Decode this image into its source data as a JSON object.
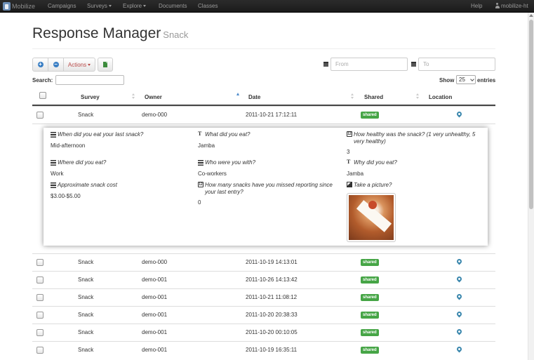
{
  "nav": {
    "brand": "Mobilize",
    "items": [
      {
        "label": "Campaigns",
        "dropdown": false
      },
      {
        "label": "Surveys",
        "dropdown": true
      },
      {
        "label": "Explore",
        "dropdown": true
      },
      {
        "label": "Documents",
        "dropdown": false
      },
      {
        "label": "Classes",
        "dropdown": false
      }
    ],
    "help": "Help",
    "user": "mobilize-ht"
  },
  "header": {
    "title": "Response Manager",
    "subtitle": "Snack"
  },
  "toolbar": {
    "actions_label": "Actions",
    "from_placeholder": "From",
    "to_placeholder": "To"
  },
  "search": {
    "label": "Search:",
    "value": ""
  },
  "pagesize": {
    "show_label": "Show",
    "value": "25",
    "entries_label": "entries"
  },
  "columns": {
    "survey": "Survey",
    "owner": "Owner",
    "date": "Date",
    "shared": "Shared",
    "location": "Location"
  },
  "expanded_row": {
    "survey": "Snack",
    "owner": "demo-000",
    "date": "2011-10-21 17:12:11",
    "status": "shared"
  },
  "details": [
    {
      "question": "When did you eat your last snack?",
      "answer": "Mid-afternoon",
      "icon": "list-icon"
    },
    {
      "question": "What did you eat?",
      "answer": "Jamba",
      "icon": "text-icon"
    },
    {
      "question": "How healthy was the snack? (1 very unhealthy, 5 very healthy)",
      "answer": "3",
      "icon": "number-icon"
    },
    {
      "question": "Where did you eat?",
      "answer": "Work",
      "icon": "list-icon"
    },
    {
      "question": "Who were you with?",
      "answer": "Co-workers",
      "icon": "list-icon"
    },
    {
      "question": "Why did you eat?",
      "answer": "Jamba",
      "icon": "text-icon"
    },
    {
      "question": "Approximate snack cost",
      "answer": "$3.00-$5.00",
      "icon": "list-icon"
    },
    {
      "question": "How many snacks have you missed reporting since your last entry?",
      "answer": "0",
      "icon": "number-icon"
    },
    {
      "question": "Take a picture?",
      "answer": "",
      "icon": "picture-icon"
    }
  ],
  "rows": [
    {
      "survey": "Snack",
      "owner": "demo-000",
      "date": "2011-10-19 14:13:01",
      "status": "shared"
    },
    {
      "survey": "Snack",
      "owner": "demo-001",
      "date": "2011-10-26 14:13:42",
      "status": "shared"
    },
    {
      "survey": "Snack",
      "owner": "demo-001",
      "date": "2011-10-21 11:08:12",
      "status": "shared"
    },
    {
      "survey": "Snack",
      "owner": "demo-001",
      "date": "2011-10-20 20:38:33",
      "status": "shared"
    },
    {
      "survey": "Snack",
      "owner": "demo-001",
      "date": "2011-10-20 00:10:05",
      "status": "shared"
    },
    {
      "survey": "Snack",
      "owner": "demo-001",
      "date": "2011-10-19 16:35:11",
      "status": "shared"
    }
  ],
  "colors": {
    "shared_badge": "#46a546",
    "location_pin": "#3a87ad",
    "navbar": "#1b1b1b",
    "actions_text": "#b94a48"
  }
}
